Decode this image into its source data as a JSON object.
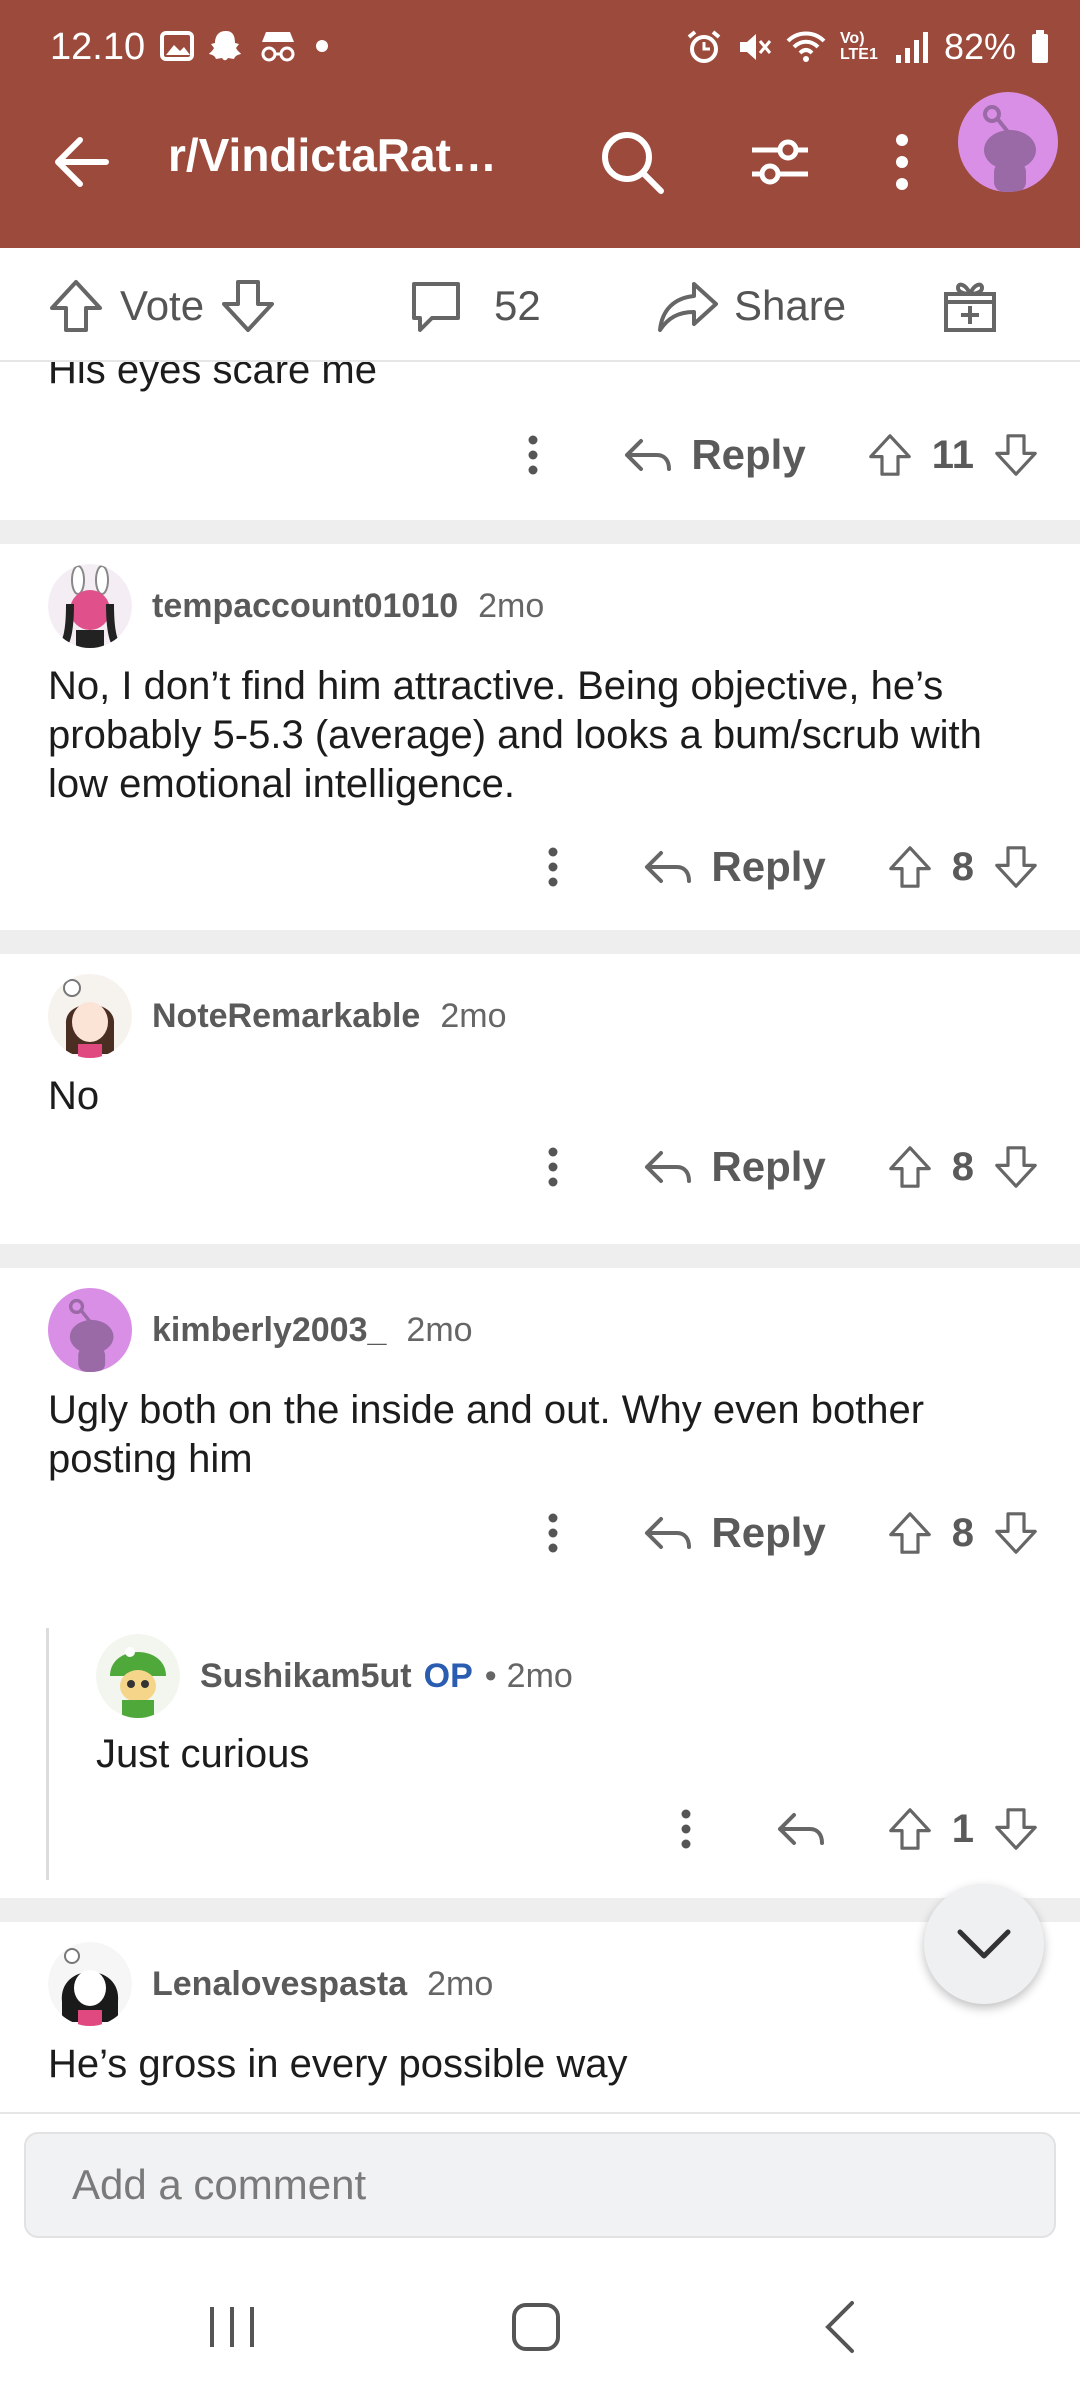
{
  "status_bar": {
    "time": "12.10",
    "battery": "82%",
    "network": "Vo) LTE1"
  },
  "header": {
    "title": "r/VindictaRat…",
    "icons": [
      "back-arrow-icon",
      "search-icon",
      "sort-icon",
      "more-vertical-icon"
    ],
    "accent_color": "#9c4a3c"
  },
  "post_actions": {
    "vote_label": "Vote",
    "comment_count": "52",
    "share_label": "Share"
  },
  "comments": [
    {
      "body": "His eyes scare me",
      "reply_label": "Reply",
      "score": "11"
    },
    {
      "username": "tempaccount01010",
      "time": "2mo",
      "body": "No, I don’t find him attractive. Being objective, he’s probably 5-5.3 (average) and looks a bum/scrub with low emotional intelligence.",
      "reply_label": "Reply",
      "score": "8"
    },
    {
      "username": "NoteRemarkable",
      "time": "2mo",
      "body": "No",
      "reply_label": "Reply",
      "score": "8"
    },
    {
      "username": "kimberly2003_",
      "time": "2mo",
      "body": "Ugly both on the inside and out. Why even bother posting him",
      "reply_label": "Reply",
      "score": "8"
    },
    {
      "username": "Sushikam5ut",
      "op_badge": "OP",
      "separator": "•",
      "time": "2mo",
      "body": "Just curious",
      "score": "1"
    },
    {
      "username": "Lenalovespasta",
      "time": "2mo",
      "body": "He’s gross in every possible way"
    }
  ],
  "composer": {
    "placeholder": "Add a comment"
  }
}
